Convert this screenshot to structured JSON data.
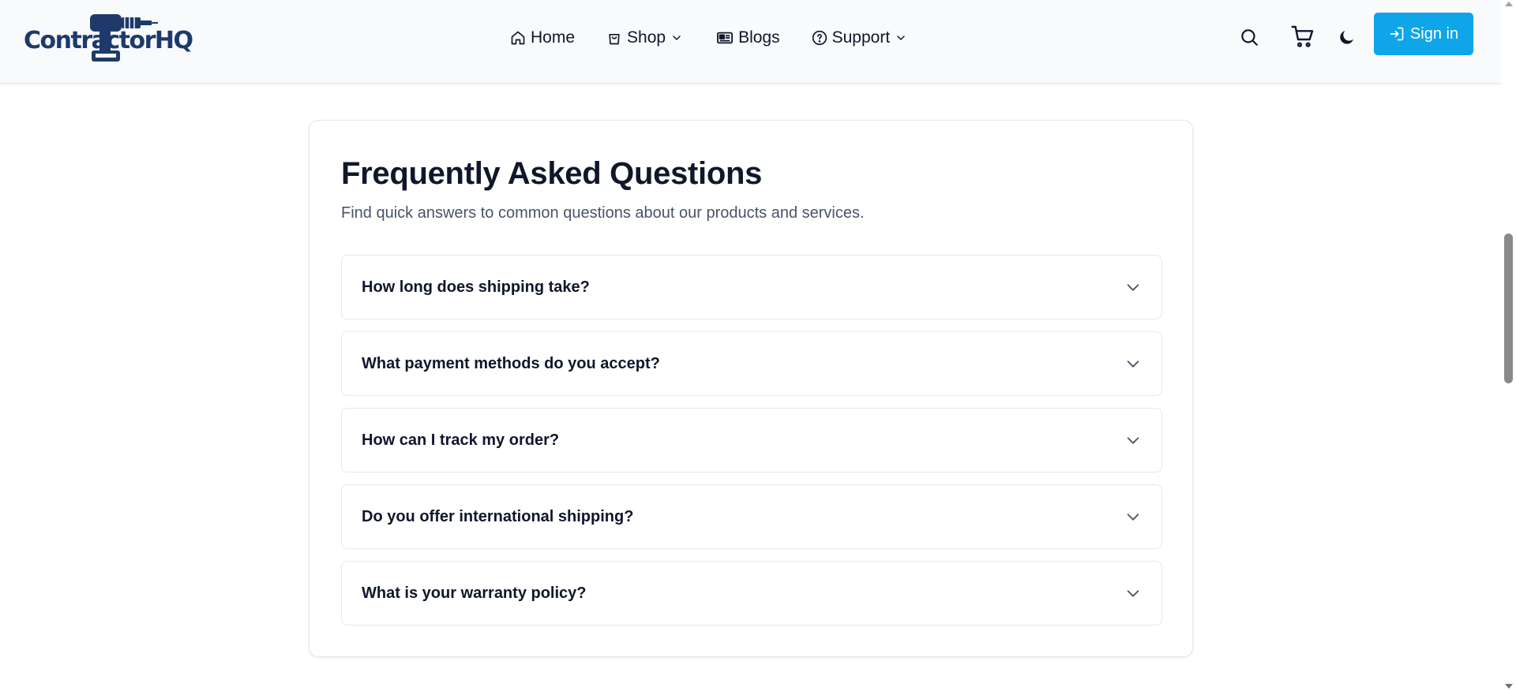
{
  "brand": {
    "name_main": "Contractor",
    "name_suffix": "HQ",
    "color": "#1e3a6b"
  },
  "nav": {
    "items": [
      {
        "label": "Home",
        "icon": "home-icon"
      },
      {
        "label": "Shop",
        "icon": "shopping-bag-icon",
        "has_dropdown": true
      },
      {
        "label": "Blogs",
        "icon": "newspaper-icon"
      },
      {
        "label": "Support",
        "icon": "help-circle-icon",
        "has_dropdown": true
      }
    ]
  },
  "actions": {
    "search_icon": "search-icon",
    "cart_icon": "cart-icon",
    "theme_icon": "moon-icon",
    "signin_label": "Sign in",
    "signin_icon": "login-icon",
    "signin_color": "#0ea5e9"
  },
  "faq": {
    "title": "Frequently Asked Questions",
    "subtitle": "Find quick answers to common questions about our products and services.",
    "items": [
      {
        "question": "How long does shipping take?"
      },
      {
        "question": "What payment methods do you accept?"
      },
      {
        "question": "How can I track my order?"
      },
      {
        "question": "Do you offer international shipping?"
      },
      {
        "question": "What is your warranty policy?"
      }
    ]
  }
}
